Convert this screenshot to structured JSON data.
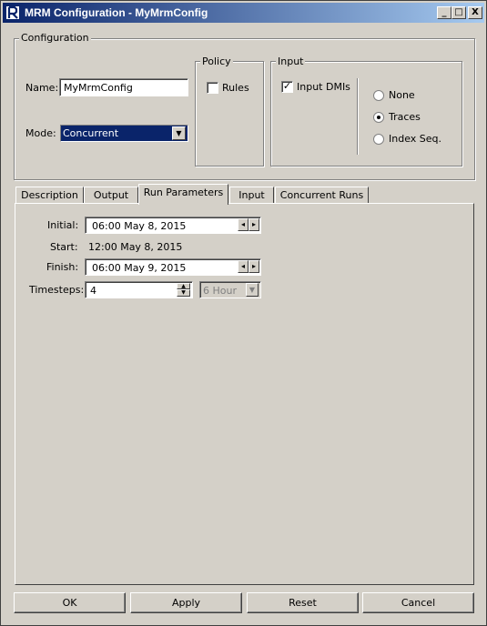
{
  "window": {
    "title": "MRM Configuration - MyMrmConfig",
    "controls": {
      "minimize": "_",
      "maximize": "□",
      "close": "X"
    }
  },
  "configuration": {
    "group_label": "Configuration",
    "name_label": "Name:",
    "name_value": "MyMrmConfig",
    "mode_label": "Mode:",
    "mode_value": "Concurrent"
  },
  "policy": {
    "group_label": "Policy",
    "rules_label": "Rules",
    "rules_checked": false
  },
  "input": {
    "group_label": "Input",
    "dmis_label": "Input DMIs",
    "dmis_checked": true,
    "radio_none": "None",
    "radio_traces": "Traces",
    "radio_index": "Index Seq.",
    "selected": "Traces"
  },
  "tabs": [
    {
      "label": "Description"
    },
    {
      "label": "Output"
    },
    {
      "label": "Run Parameters"
    },
    {
      "label": "Input"
    },
    {
      "label": "Concurrent Runs"
    }
  ],
  "active_tab": "Run Parameters",
  "run_params": {
    "initial_label": "Initial:",
    "initial_value": "06:00 May 8, 2015",
    "start_label": "Start:",
    "start_value": "12:00 May 8, 2015",
    "finish_label": "Finish:",
    "finish_value": "06:00 May 9, 2015",
    "timesteps_label": "Timesteps:",
    "timesteps_value": "4",
    "timestep_unit": "6 Hour"
  },
  "buttons": {
    "ok": "OK",
    "apply": "Apply",
    "reset": "Reset",
    "cancel": "Cancel"
  },
  "colors": {
    "title_start": "#0a246a",
    "title_end": "#a6caf0",
    "face": "#d4d0c8",
    "selection": "#0a246a"
  }
}
